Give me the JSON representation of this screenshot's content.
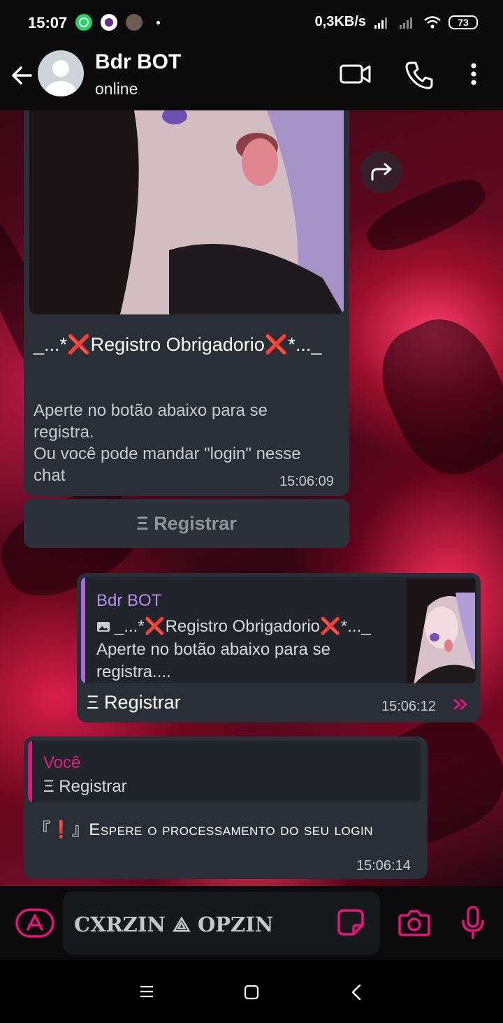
{
  "status_bar": {
    "time": "15:07",
    "network_speed": "0,3KB/s",
    "battery": "73"
  },
  "header": {
    "title": "Bdr BOT",
    "subtitle": "online"
  },
  "messages": {
    "msg1": {
      "title": "_...*❌Registro Obrigadorio❌*..._",
      "body": "Aperte no botão abaixo para se registra.\nOu você pode mandar \"login\" nesse chat",
      "time": "15:06:09",
      "button_label": "Ξ Registrar"
    },
    "msg2": {
      "quote_name": "Bdr BOT",
      "quote_line1": "_...*❌Registro Obrigadorio❌*..._",
      "quote_line2": "Aperte no botão abaixo para se registra....",
      "text": "Ξ Registrar",
      "time": "15:06:12"
    },
    "msg3": {
      "quote_name": "Você",
      "quote_text": "Ξ Registrar",
      "text": "『❗』Espere o processamento do seu login",
      "time": "15:06:14"
    }
  },
  "input_bar": {
    "value": "CXRZIN ⟁ OPZIN"
  },
  "colors": {
    "accent_pink": "#e8127c",
    "bubble": "#2a2f37",
    "quote_purple": "#a86ad6"
  }
}
